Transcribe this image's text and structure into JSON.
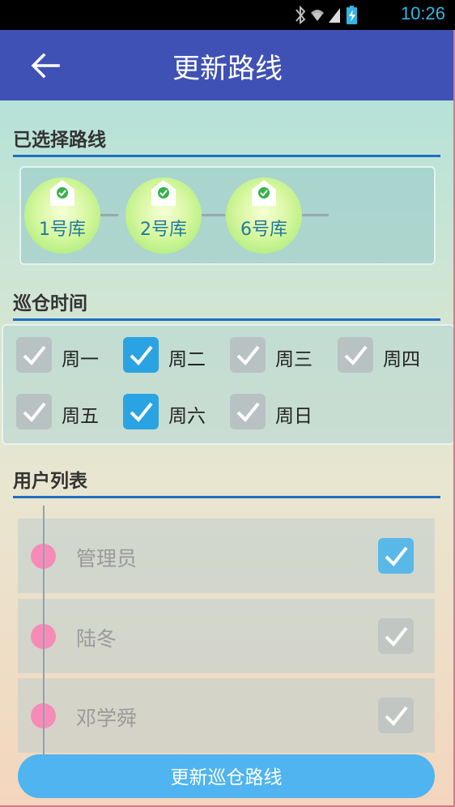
{
  "status_bar": {
    "time": "10:26"
  },
  "app_bar": {
    "title": "更新路线"
  },
  "sections": {
    "selected_route": "已选择路线",
    "patrol_time": "巡仓时间",
    "user_list": "用户列表"
  },
  "route_nodes": [
    {
      "label": "1号库"
    },
    {
      "label": "2号库"
    },
    {
      "label": "6号库"
    }
  ],
  "days": [
    {
      "label": "周一",
      "checked": false
    },
    {
      "label": "周二",
      "checked": true
    },
    {
      "label": "周三",
      "checked": false
    },
    {
      "label": "周四",
      "checked": false
    },
    {
      "label": "周五",
      "checked": false
    },
    {
      "label": "周六",
      "checked": true
    },
    {
      "label": "周日",
      "checked": false
    }
  ],
  "users": [
    {
      "name": "管理员",
      "checked": true
    },
    {
      "name": "陆冬",
      "checked": false
    },
    {
      "name": "邓学舜",
      "checked": false
    }
  ],
  "submit_label": "更新巡仓路线",
  "colors": {
    "app_bar": "#3f51b5",
    "accent": "#2aa3e3",
    "rule": "#1e6fc5",
    "dot": "#f78bb8"
  }
}
